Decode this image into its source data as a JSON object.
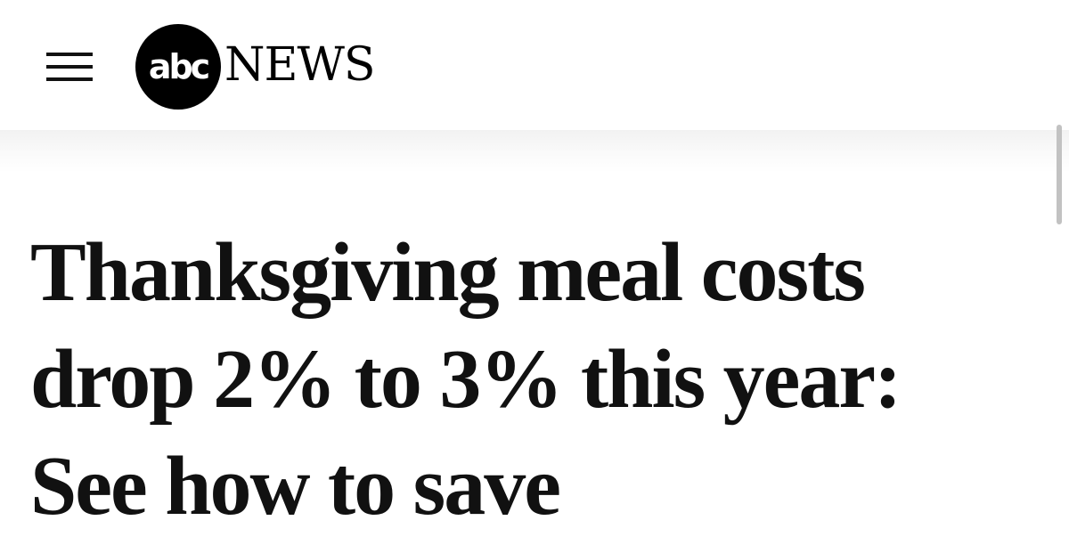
{
  "header": {
    "menu_icon": "hamburger-menu-icon",
    "logo": {
      "circle_text": "abc",
      "wordmark": "NEWS"
    }
  },
  "article": {
    "headline_lines": [
      "Thanksgiving meal costs",
      "drop 2% to 3% this year:",
      "See how to save"
    ]
  },
  "colors": {
    "background": "#ffffff",
    "text": "#111111",
    "logo": "#000000",
    "scrollbar": "#c2c2c2"
  }
}
